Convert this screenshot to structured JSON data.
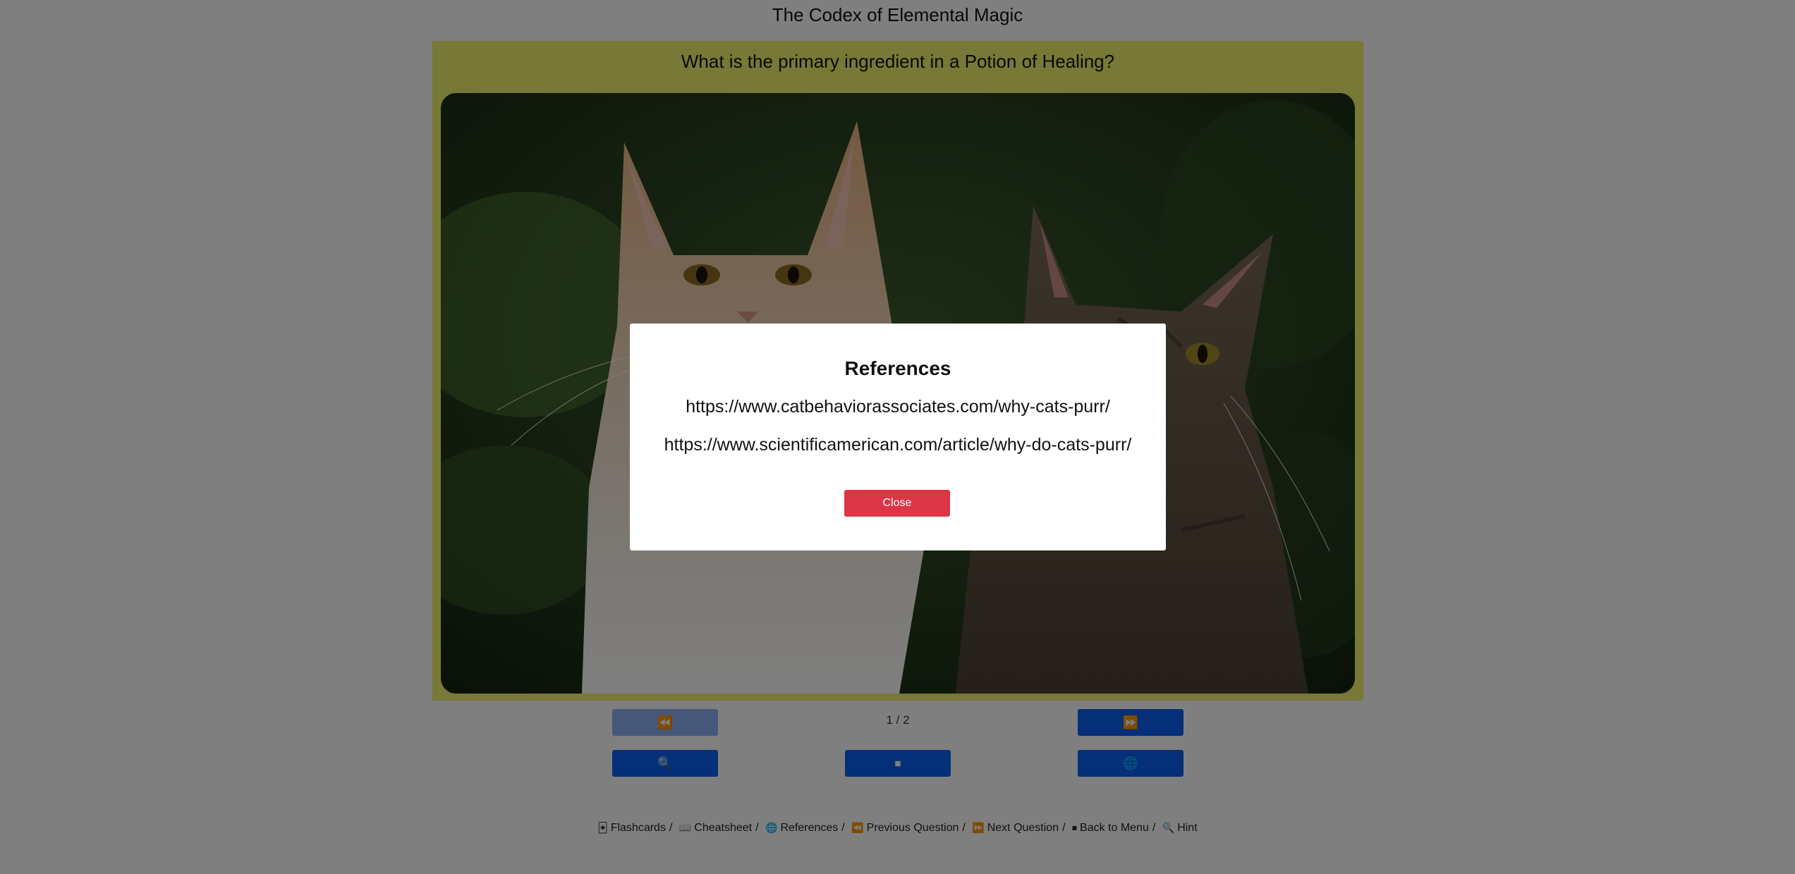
{
  "app": {
    "title": "The Codex of Elemental Magic"
  },
  "card": {
    "question": "What is the primary ingredient in a Potion of Healing?",
    "background_color": "#f0f06e"
  },
  "navigation": {
    "prev_icon": "⏪",
    "next_icon": "⏩",
    "counter": "1 / 2",
    "hint_icon": "🔍",
    "menu_icon": "⏹",
    "references_icon": "🌐",
    "button_color": "#0b5ff0"
  },
  "footer": {
    "items": [
      {
        "icon": "🃏",
        "label": "Flashcards"
      },
      {
        "icon": "📖",
        "label": "Cheatsheet"
      },
      {
        "icon": "🌐",
        "label": "References"
      },
      {
        "icon": "⏪",
        "label": "Previous Question"
      },
      {
        "icon": "⏩",
        "label": "Next Question"
      },
      {
        "icon": "⏹",
        "label": "Back to Menu"
      },
      {
        "icon": "🔍",
        "label": "Hint"
      }
    ],
    "separator": "/"
  },
  "modal": {
    "title": "References",
    "links": [
      "https://www.catbehaviorassociates.com/why-cats-purr/",
      "https://www.scientificamerican.com/article/why-do-cats-purr/"
    ],
    "close_label": "Close",
    "close_color": "#dc3545"
  }
}
